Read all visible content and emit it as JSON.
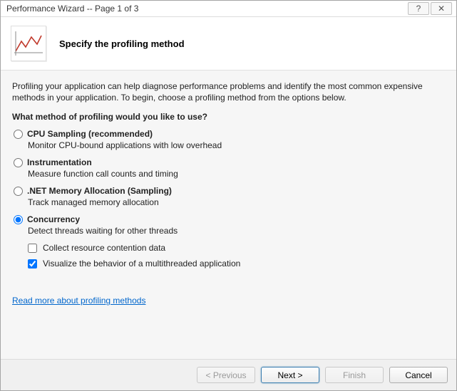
{
  "window": {
    "title": "Performance Wizard  --  Page 1 of 3"
  },
  "header": {
    "heading": "Specify the profiling method"
  },
  "body": {
    "intro": "Profiling your application can help diagnose performance problems and identify the most common expensive methods in your application. To begin, choose a profiling method from the options below.",
    "question": "What method of profiling would you like to use?",
    "options": [
      {
        "label": "CPU Sampling (recommended)",
        "desc": "Monitor CPU-bound applications with low overhead",
        "selected": false
      },
      {
        "label": "Instrumentation",
        "desc": "Measure function call counts and timing",
        "selected": false
      },
      {
        "label": ".NET Memory Allocation (Sampling)",
        "desc": "Track managed memory allocation",
        "selected": false
      },
      {
        "label": "Concurrency",
        "desc": "Detect threads waiting for other threads",
        "selected": true,
        "subchecks": [
          {
            "label": "Collect resource contention data",
            "checked": false
          },
          {
            "label": "Visualize the behavior of a multithreaded application",
            "checked": true
          }
        ]
      }
    ],
    "link": "Read more about profiling methods"
  },
  "footer": {
    "previous": "< Previous",
    "next": "Next >",
    "finish": "Finish",
    "cancel": "Cancel"
  }
}
